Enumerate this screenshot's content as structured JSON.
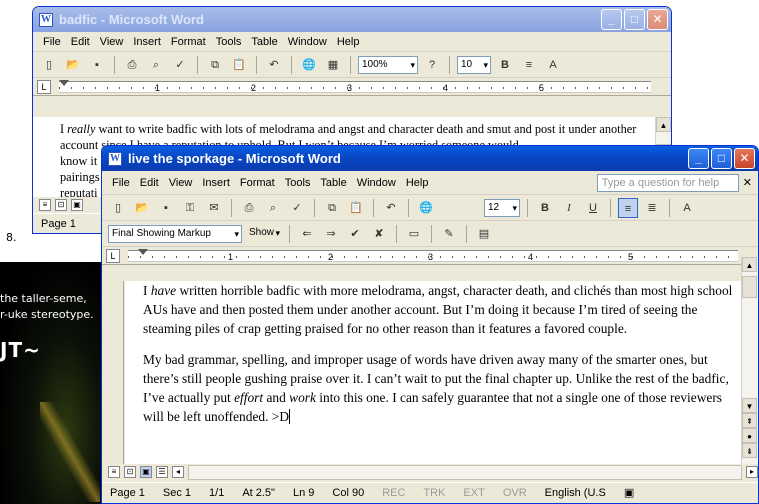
{
  "background": {
    "line1": "the taller-seme,",
    "line2": "r-uke stereotype.",
    "big": "JT~",
    "number": "8."
  },
  "back_window": {
    "title": "badfic - Microsoft Word",
    "menu": [
      "File",
      "Edit",
      "View",
      "Insert",
      "Format",
      "Tools",
      "Table",
      "Window",
      "Help"
    ],
    "zoom": "100%",
    "font_size": "10",
    "ruler_numbers": [
      "1",
      "2",
      "3",
      "4",
      "5"
    ],
    "text_before": "I ",
    "text_em": "really",
    "text_after": " want to write badfic with lots of melodrama and angst and character death and smut and post it under another account since I have a reputation to uphold. But I won’t because I’m worried someone would",
    "line3": "know it",
    "line4": "pairings",
    "line5": "reputati",
    "status_page": "Page 1"
  },
  "front_window": {
    "title": "live the sporkage - Microsoft Word",
    "menu": [
      "File",
      "Edit",
      "View",
      "Insert",
      "Format",
      "Tools",
      "Table",
      "Window",
      "Help"
    ],
    "help_placeholder": "Type a question for help",
    "font_size": "12",
    "markup_mode": "Final Showing Markup",
    "show_label": "Show",
    "ruler_numbers": [
      "1",
      "2",
      "3",
      "4",
      "5"
    ],
    "para1_a": "I ",
    "para1_em": "have",
    "para1_b": " written horrible badfic with more melodrama, angst, character death, and clichés than most high school AUs have and then posted them under another account. But I’m doing it because I’m tired of seeing the steaming piles of crap getting praised for no other reason than it features a favored couple.",
    "para2_a": "My bad grammar, spelling, and improper usage of words have driven away many of the smarter ones, but there’s still people gushing praise over it. I can’t wait to put the final chapter up. Unlike the rest of the badfic, I’ve actually put ",
    "para2_em1": "effort",
    "para2_mid": " and ",
    "para2_em2": "work",
    "para2_b": " into this one. I can safely guarantee that not a single one of those reviewers will be left unoffended. >D",
    "status": {
      "page": "Page 1",
      "sec": "Sec 1",
      "pages": "1/1",
      "at": "At 2.5\"",
      "ln": "Ln 9",
      "col": "Col 90",
      "rec": "REC",
      "trk": "TRK",
      "ext": "EXT",
      "ovr": "OVR",
      "lang": "English (U.S"
    }
  }
}
